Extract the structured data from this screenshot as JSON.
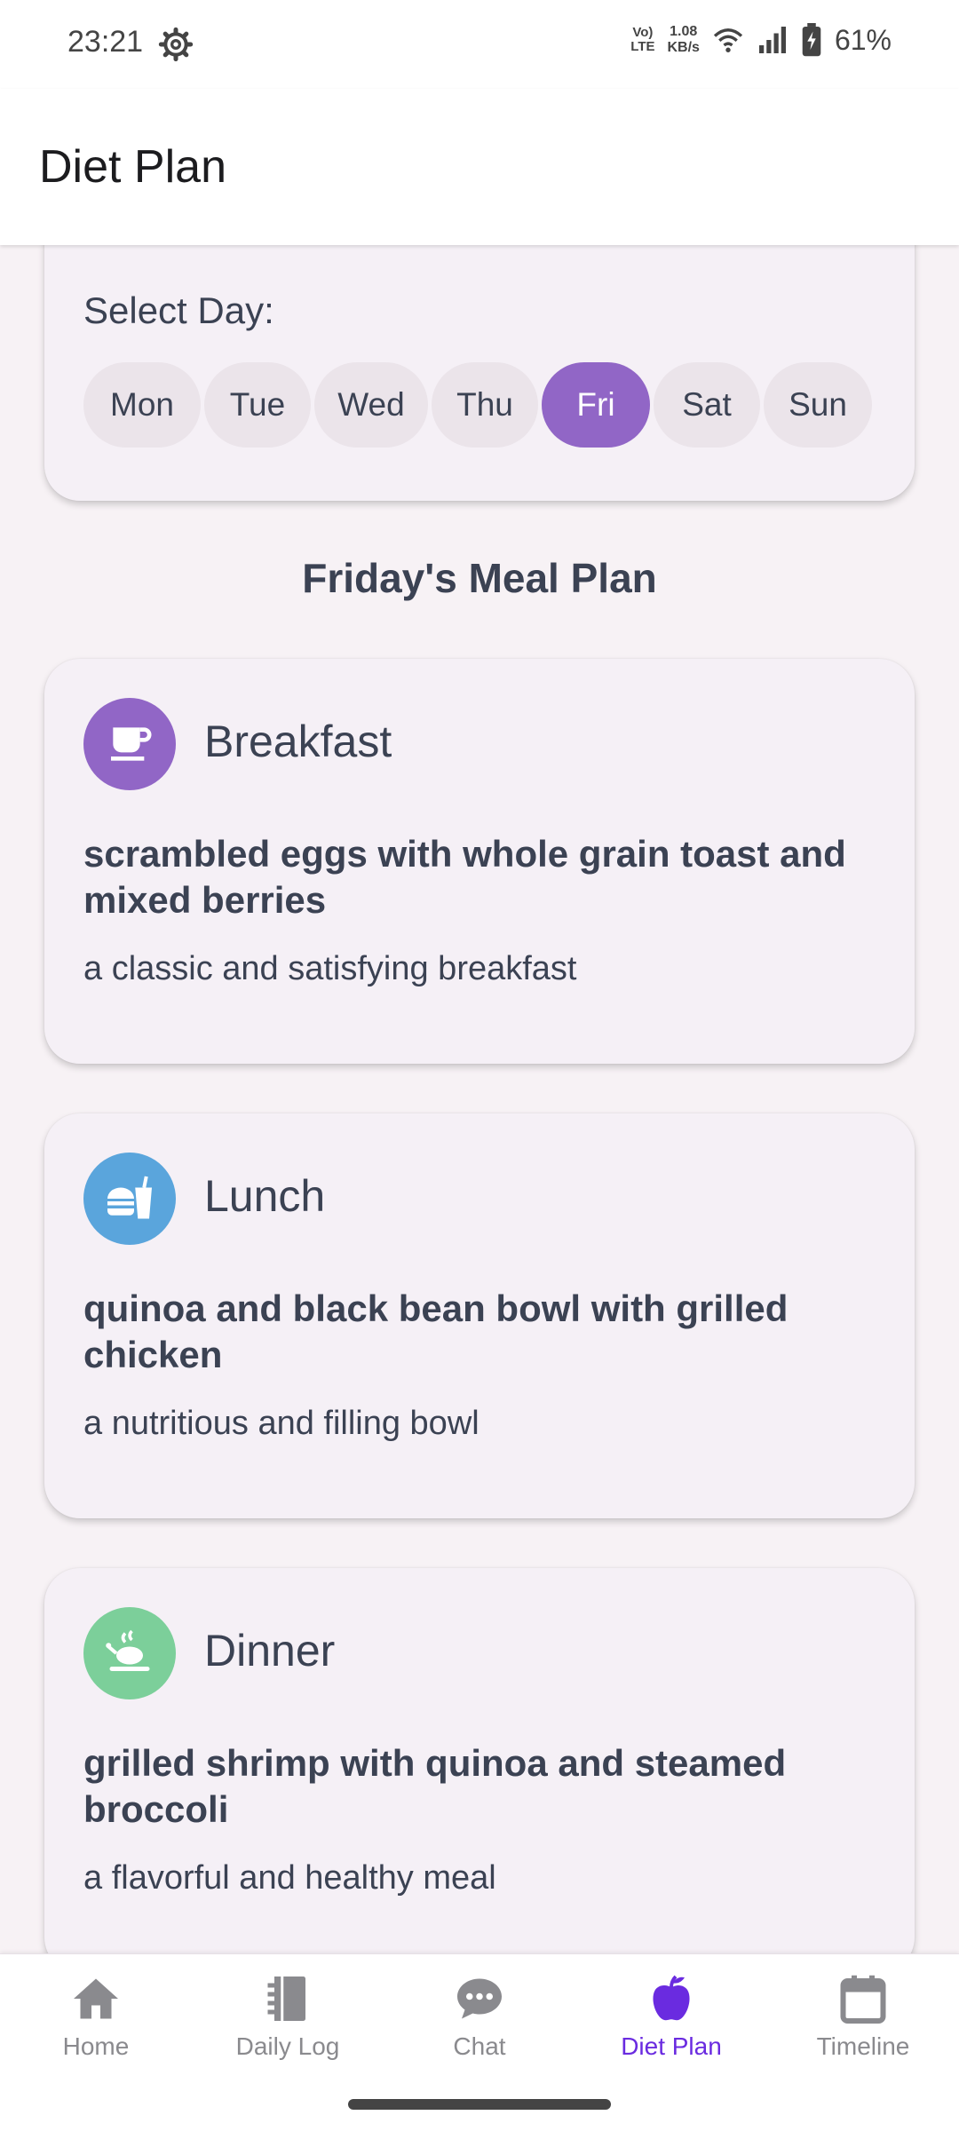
{
  "status_bar": {
    "time": "23:21",
    "settings_icon": "gear-icon",
    "network_type_top": "Vo)",
    "network_type_bottom": "LTE",
    "speed_value": "1.08",
    "speed_unit": "KB/s",
    "battery": "61%"
  },
  "app_bar": {
    "title": "Diet Plan"
  },
  "day_selector": {
    "label": "Select Day:",
    "days": [
      "Mon",
      "Tue",
      "Wed",
      "Thu",
      "Fri",
      "Sat",
      "Sun"
    ],
    "selected": "Fri",
    "selected_color": "#9166c6"
  },
  "plan_title": "Friday's Meal Plan",
  "meals": [
    {
      "name": "Breakfast",
      "icon": "coffee-cup-icon",
      "icon_color": "#9166c6",
      "title": "scrambled eggs with whole grain toast and mixed berries",
      "description": "a classic and satisfying breakfast"
    },
    {
      "name": "Lunch",
      "icon": "burger-drink-icon",
      "icon_color": "#5aa5dc",
      "title": "quinoa and black bean bowl with grilled chicken",
      "description": "a nutritious and filling bowl"
    },
    {
      "name": "Dinner",
      "icon": "roast-dinner-icon",
      "icon_color": "#7ccf9a",
      "title": "grilled shrimp with quinoa and steamed broccoli",
      "description": "a flavorful and healthy meal"
    }
  ],
  "bottom_nav": {
    "items": [
      {
        "label": "Home",
        "icon": "home-icon"
      },
      {
        "label": "Daily Log",
        "icon": "notebook-icon"
      },
      {
        "label": "Chat",
        "icon": "chat-bubble-icon"
      },
      {
        "label": "Diet Plan",
        "icon": "apple-icon"
      },
      {
        "label": "Timeline",
        "icon": "calendar-icon"
      }
    ],
    "active": "Diet Plan",
    "active_color": "#6a2be0"
  }
}
